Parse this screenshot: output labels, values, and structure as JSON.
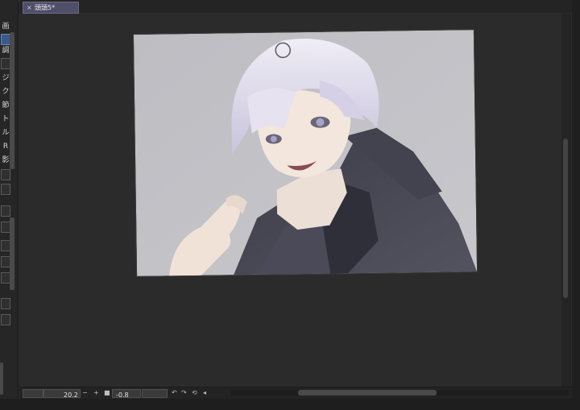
{
  "window": {
    "document_tab": "頭頭5*",
    "tab_close_glyph": "×"
  },
  "left_toolbar": {
    "labels": [
      "画",
      "調",
      "ジ",
      "ク",
      "節",
      "ト",
      "ル",
      "R",
      "影"
    ]
  },
  "status_bar": {
    "zoom_value": "20.2",
    "zoom_minus": "−",
    "zoom_plus": "+",
    "rotation_value": "-0.8",
    "icons": [
      "rotate-left-icon",
      "rotate-right-icon",
      "reset-rotation-icon",
      "flip-icon"
    ]
  },
  "colors": {
    "app_background": "#2a2a2a",
    "canvas_paper": "#c3c3c7",
    "tab_active": "#4f4f6a"
  }
}
